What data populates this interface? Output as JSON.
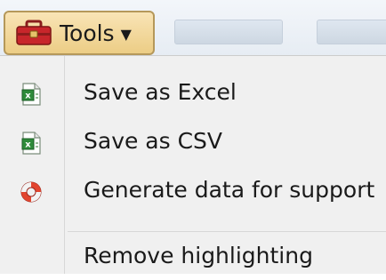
{
  "toolbar": {
    "tools_label": "Tools",
    "tools_icon": "toolbox-icon",
    "caret_icon": "caret-down-icon"
  },
  "menu": {
    "items": [
      {
        "label": "Save as Excel",
        "icon": "excel-icon"
      },
      {
        "label": "Save as CSV",
        "icon": "csv-icon"
      },
      {
        "label": "Generate data for support",
        "icon": "lifebuoy-icon"
      },
      {
        "label": "Remove highlighting",
        "icon": ""
      }
    ]
  },
  "colors": {
    "tools_button_bg": "#f0d596",
    "tools_button_border": "#b5985a",
    "menu_bg": "#f0f0f0",
    "toolbox_red": "#c8262b"
  }
}
